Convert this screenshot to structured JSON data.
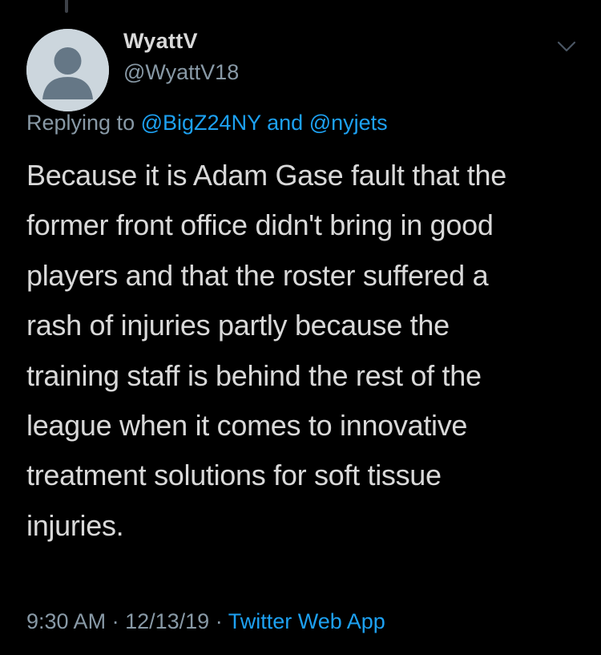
{
  "user": {
    "display_name": "WyattV",
    "handle": "@WyattV18",
    "avatar_icon": "default-profile-icon"
  },
  "reply_context": {
    "prefix": "Replying to",
    "mentions": [
      "@BigZ24NY",
      "@nyjets"
    ],
    "joiner": "and"
  },
  "tweet": {
    "lines": [
      "Because it is Adam Gase fault that the",
      "former front office didn't bring in good",
      "players and that the roster suffered a",
      "rash of injuries partly because the",
      "training staff is behind the rest of the",
      "league when it comes to innovative",
      "treatment solutions for soft tissue",
      "injuries."
    ]
  },
  "meta": {
    "time": "9:30 AM",
    "separator": "·",
    "date": "12/13/19",
    "source": "Twitter Web App"
  },
  "icons": {
    "menu": "chevron-down-icon"
  },
  "colors": {
    "background": "#000000",
    "text": "#d9d9d9",
    "secondary": "#8899a6",
    "link": "#1da1f2"
  }
}
